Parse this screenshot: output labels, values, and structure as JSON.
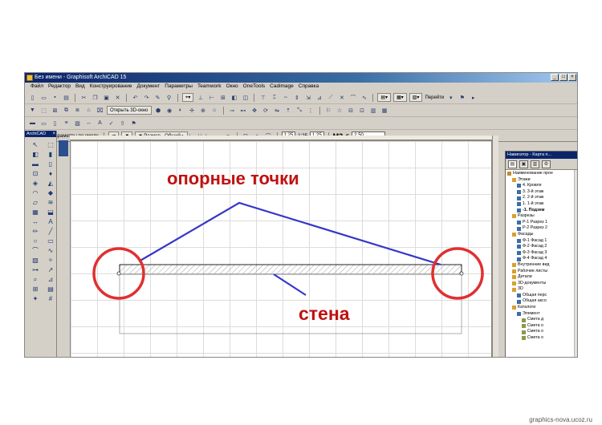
{
  "window": {
    "title": "Без имени - Graphisoft ArchiCAD 15",
    "buttons": [
      "_",
      "□",
      "×"
    ]
  },
  "menu": [
    "Файл",
    "Редактор",
    "Вид",
    "Конструирование",
    "Документ",
    "Параметры",
    "Teamwork",
    "Окно",
    "OneTools",
    "Cadimage",
    "Справка"
  ],
  "toolbar": {
    "goto_label": "Перейти",
    "open_3d_label": "Открыть 3D-окно"
  },
  "info_box": {
    "params_label": "Параметры по умолч.",
    "dimension_dropdown": "Размер - Общий",
    "scale_a": "1:25",
    "scale_b": "1:25",
    "scale_c": "1:25",
    "m3_label": "M3",
    "m3_value": "2,50"
  },
  "toolbox": {
    "title": "ArchiCAD",
    "tools": [
      "arrow-tool-icon",
      "marquee-tool-icon",
      "wall-tool-icon",
      "column-tool-icon",
      "beam-tool-icon",
      "door-tool-icon",
      "window-tool-icon",
      "object-tool-icon",
      "slab-tool-icon",
      "roof-tool-icon",
      "shell-tool-icon",
      "morph-tool-icon",
      "mesh-tool-icon",
      "stair-tool-icon",
      "curtain-wall-tool-icon",
      "zone-tool-icon",
      "dimension-tool-icon",
      "text-tool-icon",
      "label-tool-icon",
      "line-tool-icon",
      "circle-tool-icon",
      "polyline-tool-icon",
      "arc-tool-icon",
      "spline-tool-icon",
      "fill-tool-icon",
      "hotspot-tool-icon",
      "section-tool-icon",
      "elevation-tool-icon",
      "camera-tool-icon",
      "figure-tool-icon",
      "detail-tool-icon",
      "worksheet-tool-icon",
      "lamp-tool-icon",
      "grid-tool-icon"
    ]
  },
  "navigator": {
    "title": "Навигатор - Карта п...",
    "items": [
      {
        "label": "Наименование прое",
        "level": 0
      },
      {
        "label": "Этажи",
        "level": 1
      },
      {
        "label": "4. Кровля",
        "level": 2
      },
      {
        "label": "3. 3-й этаж",
        "level": 2
      },
      {
        "label": "2. 2-й этаж",
        "level": 2
      },
      {
        "label": "1. 1-й этаж",
        "level": 2
      },
      {
        "label": "-1. Подзем",
        "level": 2,
        "bold": true
      },
      {
        "label": "Разрезы",
        "level": 1
      },
      {
        "label": "Р-1 Разрез 1",
        "level": 2
      },
      {
        "label": "Р-2 Разрез 2",
        "level": 2
      },
      {
        "label": "Фасады",
        "level": 1
      },
      {
        "label": "Ф-1 Фасад 1",
        "level": 2
      },
      {
        "label": "Ф-2 Фасад 2",
        "level": 2
      },
      {
        "label": "Ф-3 Фасад 3",
        "level": 2
      },
      {
        "label": "Ф-4 Фасад 4",
        "level": 2
      },
      {
        "label": "Внутренние вид",
        "level": 1
      },
      {
        "label": "Рабочие листы",
        "level": 1
      },
      {
        "label": "Детали",
        "level": 1
      },
      {
        "label": "3D-документы",
        "level": 1
      },
      {
        "label": "3D",
        "level": 1
      },
      {
        "label": "Общая перс",
        "level": 2
      },
      {
        "label": "Общая аксо",
        "level": 2
      },
      {
        "label": "Каталоги",
        "level": 1
      },
      {
        "label": "Элемент",
        "level": 2
      },
      {
        "label": "Смета д",
        "level": 3
      },
      {
        "label": "Смета о",
        "level": 3
      },
      {
        "label": "Смета о",
        "level": 3
      },
      {
        "label": "Смета о",
        "level": 3
      }
    ]
  },
  "annotations": {
    "ref_points_label": "опорные  точки",
    "wall_label": "стена"
  },
  "watermark": "graphics-nova.ucoz.ru"
}
